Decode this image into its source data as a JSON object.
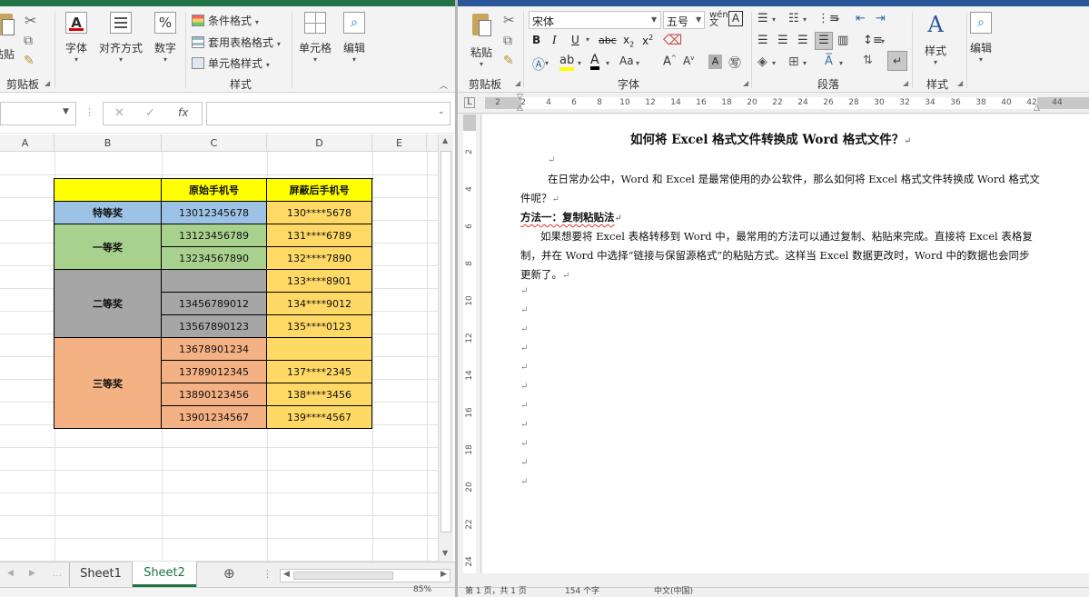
{
  "excel": {
    "ribbon": {
      "clipboard_label": "剪贴板",
      "paste_label": "粘贴",
      "font_label": "字体",
      "align_label": "对齐方式",
      "number_label": "数字",
      "conditional_label": "条件格式",
      "table_label": "套用表格格式",
      "cellstyle_label": "单元格样式",
      "styles_group": "样式",
      "cells_label": "单元格",
      "edit_label": "编辑"
    },
    "formula_bar": {
      "cancel": "✕",
      "confirm": "✓",
      "fx": "fx"
    },
    "columns": [
      "A",
      "B",
      "C",
      "D",
      "E"
    ],
    "table": {
      "headers": [
        "",
        "原始手机号",
        "屏蔽后手机号"
      ],
      "groups": [
        {
          "name": "特等奖",
          "color": "#9cc3e6",
          "rows": [
            [
              "13012345678",
              "130****5678"
            ]
          ]
        },
        {
          "name": "一等奖",
          "color": "#a9d18e",
          "rows": [
            [
              "13123456789",
              "131****6789"
            ],
            [
              "13234567890",
              "132****7890"
            ]
          ]
        },
        {
          "name": "二等奖",
          "color": "#a6a6a6",
          "rows": [
            [
              "",
              "133****8901"
            ],
            [
              "13456789012",
              "134****9012"
            ],
            [
              "13567890123",
              "135****0123"
            ]
          ]
        },
        {
          "name": "三等奖",
          "color": "#f4b183",
          "rows": [
            [
              "13678901234",
              ""
            ],
            [
              "13789012345",
              "137****2345"
            ],
            [
              "13890123456",
              "138****3456"
            ],
            [
              "13901234567",
              "139****4567"
            ]
          ]
        }
      ],
      "header_color": "#ffff00",
      "masked_color": "#ffd966"
    },
    "sheets": [
      "Sheet1",
      "Sheet2"
    ],
    "active_sheet": "Sheet2",
    "zoom": "85%"
  },
  "word": {
    "ribbon": {
      "paste_label": "粘贴",
      "clipboard_label": "剪贴板",
      "font_name": "宋体",
      "font_size": "五号",
      "font_group": "字体",
      "paragraph_group": "段落",
      "styles_label": "样式",
      "styles_group": "样式",
      "edit_label": "编辑"
    },
    "ruler_numbers": [
      "2",
      "2",
      "4",
      "6",
      "8",
      "10",
      "12",
      "14",
      "16",
      "18",
      "20",
      "22",
      "24",
      "26",
      "28",
      "30",
      "32",
      "34",
      "36",
      "38",
      "40",
      "42",
      "44"
    ],
    "vruler_numbers": [
      "2",
      "4",
      "6",
      "8",
      "10",
      "12",
      "14",
      "16",
      "18",
      "20",
      "22",
      "24"
    ],
    "doc": {
      "title": "如何将 Excel 格式文件转换成 Word 格式文件？",
      "para1_line1": "在日常办公中，Word 和 Excel 是最常使用的办公软件，那么如何将 Excel 格式文件转换成 Word 格式文",
      "para1_line2": "件呢？",
      "method": "方法一：复制粘贴法",
      "para2_line1": "如果想要将 Excel 表格转移到 Word 中，最常用的方法可以通过复制、粘贴来完成。直接将 Excel 表格复",
      "para2_line2": "制，并在 Word 中选择“链接与保留源格式”的粘贴方式。这样当 Excel 数据更改时，Word 中的数据也会同步",
      "para2_line3": "更新了。"
    },
    "status": {
      "page": "第 1 页，共 1 页",
      "words": "154 个字",
      "lang": "中文(中国)"
    }
  }
}
